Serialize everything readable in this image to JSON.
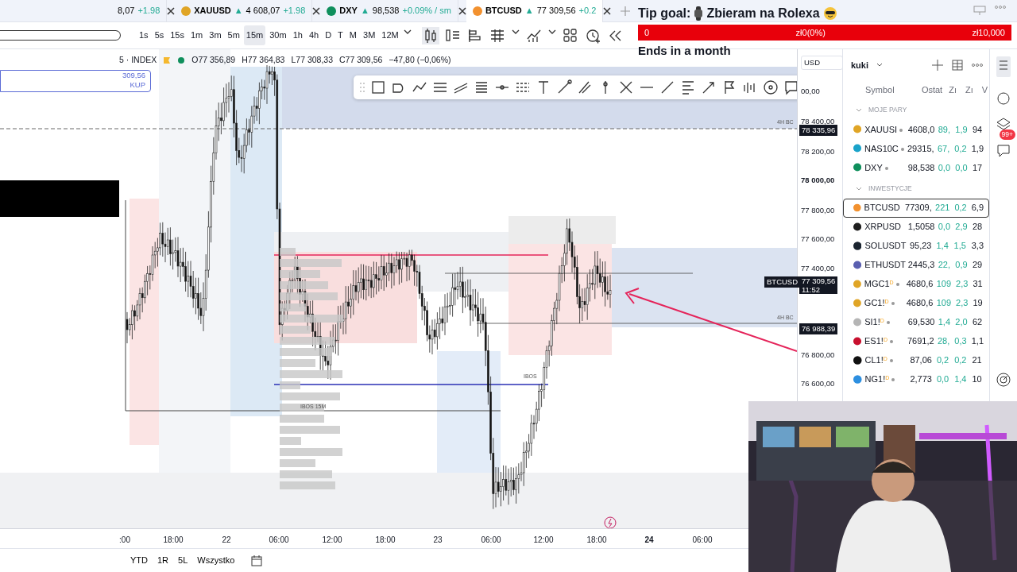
{
  "tabs": [
    {
      "price": "8,07",
      "change": "+1.98",
      "selected": false
    },
    {
      "symbol": "XAUUSD",
      "arrow": "▲",
      "price": "4 608,07",
      "change": "+1.98",
      "selected": false,
      "color": "#e0a526"
    },
    {
      "symbol": "DXY",
      "arrow": "▲",
      "price": "98,538",
      "change": "+0.09% / sm",
      "selected": false,
      "color": "#0f8f5c"
    },
    {
      "symbol": "BTCUSD",
      "arrow": "▲",
      "price": "77 309,56",
      "change": "+0.2",
      "selected": true,
      "color": "#f2912f"
    }
  ],
  "intervals": [
    {
      "label": "1s",
      "selected": false
    },
    {
      "label": "5s",
      "selected": false
    },
    {
      "label": "15s",
      "selected": false
    },
    {
      "label": "1m",
      "selected": false
    },
    {
      "label": "3m",
      "selected": false
    },
    {
      "label": "5m",
      "selected": false
    },
    {
      "label": "15m",
      "selected": true
    },
    {
      "label": "30m",
      "selected": false
    },
    {
      "label": "1h",
      "selected": false
    },
    {
      "label": "4h",
      "selected": false
    },
    {
      "label": "D",
      "selected": false
    },
    {
      "label": "T",
      "selected": false
    },
    {
      "label": "M",
      "selected": false
    },
    {
      "label": "3M",
      "selected": false
    },
    {
      "label": "12M",
      "selected": false
    }
  ],
  "legend": {
    "title": "5 · INDEX",
    "open": "O77 356,89",
    "high": "H77 364,83",
    "low": "L77 308,33",
    "close": "C77 309,56",
    "change": "−47,80 (−0,06%)"
  },
  "order_widget": {
    "price": "309,56",
    "action": "KUP"
  },
  "annotations": [
    {
      "text": "4H BC"
    },
    {
      "text": "4H BC"
    },
    {
      "text": "IBOS 15M"
    },
    {
      "text": "IBOS"
    }
  ],
  "price_axis": {
    "currency": "USD",
    "labels": [
      {
        "text": "00,00",
        "kind": "tick"
      },
      {
        "text": "78 400,00",
        "kind": "tick"
      },
      {
        "text": "78 335,96",
        "kind": "marker"
      },
      {
        "text": "78 200,00",
        "kind": "tick"
      },
      {
        "text": "78 000,00",
        "kind": "bold"
      },
      {
        "text": "77 800,00",
        "kind": "tick"
      },
      {
        "text": "77 600,00",
        "kind": "tick"
      },
      {
        "text": "77 400,00",
        "kind": "tick"
      },
      {
        "text": "76 988,39",
        "kind": "marker"
      },
      {
        "text": "76 800,00",
        "kind": "tick"
      },
      {
        "text": "76 600,00",
        "kind": "tick"
      }
    ],
    "last_price": {
      "symbol": "BTCUSD",
      "price": "77 309,56",
      "countdown": "11:52"
    }
  },
  "time_axis": [
    {
      "text": ":00",
      "bold": false
    },
    {
      "text": "18:00",
      "bold": false
    },
    {
      "text": "22",
      "bold": false
    },
    {
      "text": "06:00",
      "bold": false
    },
    {
      "text": "12:00",
      "bold": false
    },
    {
      "text": "18:00",
      "bold": false
    },
    {
      "text": "23",
      "bold": false
    },
    {
      "text": "06:00",
      "bold": false
    },
    {
      "text": "12:00",
      "bold": false
    },
    {
      "text": "18:00",
      "bold": false
    },
    {
      "text": "24",
      "bold": true
    },
    {
      "text": "06:00",
      "bold": false
    }
  ],
  "ranges": [
    "YTD",
    "1R",
    "5L",
    "Wszystko"
  ],
  "tip_goal": {
    "title": "Tip goal:",
    "goal": "Zbieram na Rolexa",
    "level": 0,
    "start": "0",
    "current": "zł0(0%)",
    "target": "zł10,000",
    "ends": "Ends in a month"
  },
  "watchlist": {
    "name": "kuki",
    "columns": [
      "Symbol",
      "Ostat",
      "Zı",
      "Zı",
      "V"
    ],
    "sections": [
      {
        "title": "MOJE PARY",
        "rows": [
          {
            "symbol": "XAUUSI",
            "dot": true,
            "color": "#e0a526",
            "values": [
              "4608,0",
              "89,",
              "1,9",
              "94"
            ],
            "selected": false
          },
          {
            "symbol": "NAS10C",
            "dot": true,
            "color": "#1aa3c9",
            "values": [
              "29315,",
              "67,",
              "0,2",
              "1,9"
            ],
            "selected": false
          },
          {
            "symbol": "DXY",
            "dot": true,
            "color": "#0f8f5c",
            "values": [
              "98,538",
              "0,0",
              "0,0",
              "17"
            ],
            "selected": false
          }
        ]
      },
      {
        "title": "INWESTYCJE",
        "rows": [
          {
            "symbol": "BTCUSD",
            "dot": false,
            "color": "#f2912f",
            "values": [
              "77309,",
              "221",
              "0,2",
              "6,9"
            ],
            "selected": true
          },
          {
            "symbol": "XRPUSD",
            "dot": false,
            "color": "#1e1e1e",
            "values": [
              "1,5058",
              "0,0",
              "2,9",
              "28"
            ],
            "selected": false
          },
          {
            "symbol": "SOLUSDT",
            "dot": false,
            "color": "#1b2430",
            "values": [
              "95,23",
              "1,4",
              "1,5",
              "3,3"
            ],
            "selected": false
          },
          {
            "symbol": "ETHUSDT",
            "dot": false,
            "color": "#5a5fb0",
            "values": [
              "2445,3",
              "22,",
              "0,9",
              "29"
            ],
            "selected": false
          },
          {
            "symbol": "MGC1",
            "flag": "D",
            "dot": true,
            "color": "#e0a526",
            "values": [
              "4680,6",
              "109",
              "2,3",
              "31"
            ],
            "selected": false
          },
          {
            "symbol": "GC1!",
            "flag": "D",
            "dot": true,
            "color": "#e0a526",
            "values": [
              "4680,6",
              "109",
              "2,3",
              "19"
            ],
            "selected": false
          },
          {
            "symbol": "SI1!",
            "flag": "D",
            "dot": true,
            "color": "#b5b5b5",
            "values": [
              "69,530",
              "1,4",
              "2,0",
              "62"
            ],
            "selected": false
          },
          {
            "symbol": "ES1!",
            "flag": "D",
            "dot": true,
            "color": "#c8102e",
            "values": [
              "7691,2",
              "28,",
              "0,3",
              "1,1"
            ],
            "selected": false
          },
          {
            "symbol": "CL1!",
            "flag": "D",
            "dot": true,
            "color": "#111111",
            "values": [
              "87,06",
              "0,2",
              "0,2",
              "21"
            ],
            "selected": false
          },
          {
            "symbol": "NG1!",
            "flag": "D",
            "dot": true,
            "color": "#2d8fe0",
            "values": [
              "2,773",
              "0,0",
              "1,4",
              "10"
            ],
            "selected": false
          }
        ]
      }
    ]
  },
  "notifications": {
    "badge": "99+"
  },
  "webcam": {
    "kind": "picture"
  }
}
